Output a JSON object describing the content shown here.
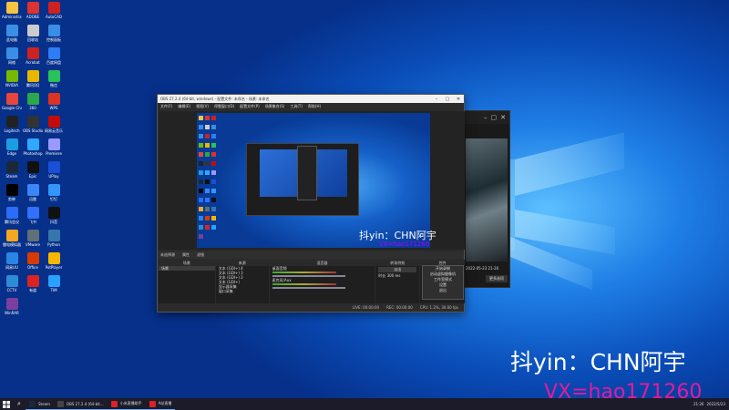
{
  "desktop": {
    "icons": [
      {
        "label": "Administrator",
        "color": "#f4c542"
      },
      {
        "label": "ADOBE",
        "color": "#d33"
      },
      {
        "label": "AutoCAD",
        "color": "#c22"
      },
      {
        "label": "此电脑",
        "color": "#3a8ee6"
      },
      {
        "label": "回收站",
        "color": "#ccc"
      },
      {
        "label": "控制面板",
        "color": "#3a8ee6"
      },
      {
        "label": "网络",
        "color": "#3a8ee6"
      },
      {
        "label": "Acrobat",
        "color": "#c22"
      },
      {
        "label": "百度网盘",
        "color": "#2e7cf6"
      },
      {
        "label": "NVIDIA",
        "color": "#76b900"
      },
      {
        "label": "腾讯QQ",
        "color": "#e6b800"
      },
      {
        "label": "微信",
        "color": "#2ac05a"
      },
      {
        "label": "Google Chrome",
        "color": "#e8453c"
      },
      {
        "label": "360",
        "color": "#2aa84a"
      },
      {
        "label": "WPS",
        "color": "#d32"
      },
      {
        "label": "Logitech",
        "color": "#222"
      },
      {
        "label": "OBS Studio",
        "color": "#333"
      },
      {
        "label": "网易云音乐",
        "color": "#c20c0c"
      },
      {
        "label": "Edge",
        "color": "#1b9de2"
      },
      {
        "label": "Photoshop",
        "color": "#31a8ff"
      },
      {
        "label": "Premiere",
        "color": "#9999ff"
      },
      {
        "label": "Steam",
        "color": "#1b2838"
      },
      {
        "label": "Epic",
        "color": "#111"
      },
      {
        "label": "UPlay",
        "color": "#1a4fd6"
      },
      {
        "label": "剪映",
        "color": "#000"
      },
      {
        "label": "迅雷",
        "color": "#3b86f7"
      },
      {
        "label": "钉钉",
        "color": "#3296fa"
      },
      {
        "label": "腾讯会议",
        "color": "#2d6cf6"
      },
      {
        "label": "飞书",
        "color": "#3370ff"
      },
      {
        "label": "抖音",
        "color": "#111"
      },
      {
        "label": "雷电模拟器",
        "color": "#f5a623"
      },
      {
        "label": "VMware",
        "color": "#607078"
      },
      {
        "label": "Python",
        "color": "#3776ab"
      },
      {
        "label": "网易UU",
        "color": "#2b85e4"
      },
      {
        "label": "Office",
        "color": "#d83b01"
      },
      {
        "label": "PotPlayer",
        "color": "#f5b700"
      },
      {
        "label": "CCTV",
        "color": "#2e8bd6"
      },
      {
        "label": "有道",
        "color": "#d22"
      },
      {
        "label": "TIM",
        "color": "#2aa1ff"
      },
      {
        "label": "WinRAR",
        "color": "#7a3fa0"
      }
    ]
  },
  "obs": {
    "title": "OBS 27.2.4 (64-bit, windows) - 配置文件: 未命名 - 场景: 未命名",
    "menu": [
      "文件(F)",
      "编辑(E)",
      "视图(V)",
      "停靠窗口(D)",
      "配置文件(P)",
      "场景集合(S)",
      "工具(T)",
      "帮助(H)"
    ],
    "source_bar": [
      "未选择源",
      "属性",
      "滤镜"
    ],
    "docks": {
      "scenes": {
        "title": "场景",
        "items": [
          "场景"
        ]
      },
      "sources": {
        "title": "来源",
        "items": [
          "文本 (GDI+) 4",
          "文本 (GDI+) 3",
          "文本 (GDI+) 2",
          "文本 (GDI+)",
          "显示器采集",
          "窗口采集"
        ]
      },
      "mixer": {
        "title": "混音器",
        "channels": [
          {
            "name": "桌面音频",
            "db": "0.0 dB"
          },
          {
            "name": "麦克风/Aux",
            "db": "0.0 dB"
          }
        ]
      },
      "transitions": {
        "title": "转场特效",
        "type": "淡出",
        "duration_label": "时长",
        "duration": "300 ms"
      },
      "controls": {
        "title": "控件",
        "buttons": [
          "开始推流",
          "开始录制",
          "启动虚拟摄像机",
          "工作室模式",
          "设置",
          "退出"
        ]
      }
    },
    "status": [
      "LIVE: 00:00:00",
      "REC: 00:00:00",
      "CPU: 1.2%, 30.00 fps"
    ]
  },
  "context_menu": [
    "开始录制",
    "启动虚拟摄像机",
    "工作室模式",
    "设置",
    "退出"
  ],
  "preview_watermark": "抖yin：CHN阿宇",
  "preview_watermark_sub": "VX=hao171260",
  "watermark": "抖yin：CHN阿宇",
  "watermark_vx": "VX=hao171260",
  "taskbar": {
    "items": [
      {
        "label": "Steam",
        "color": "#1b2838"
      },
      {
        "label": "OBS 27.2.4 (64-bit...",
        "color": "#444"
      },
      {
        "label": "小米直播助手",
        "color": "#d22"
      },
      {
        "label": "A站直播",
        "color": "#d22"
      }
    ],
    "time": "21:26",
    "date": "2022/5/23"
  },
  "backwindow": {
    "caption": "2022-05-23 21-26",
    "button": "更多选项"
  }
}
